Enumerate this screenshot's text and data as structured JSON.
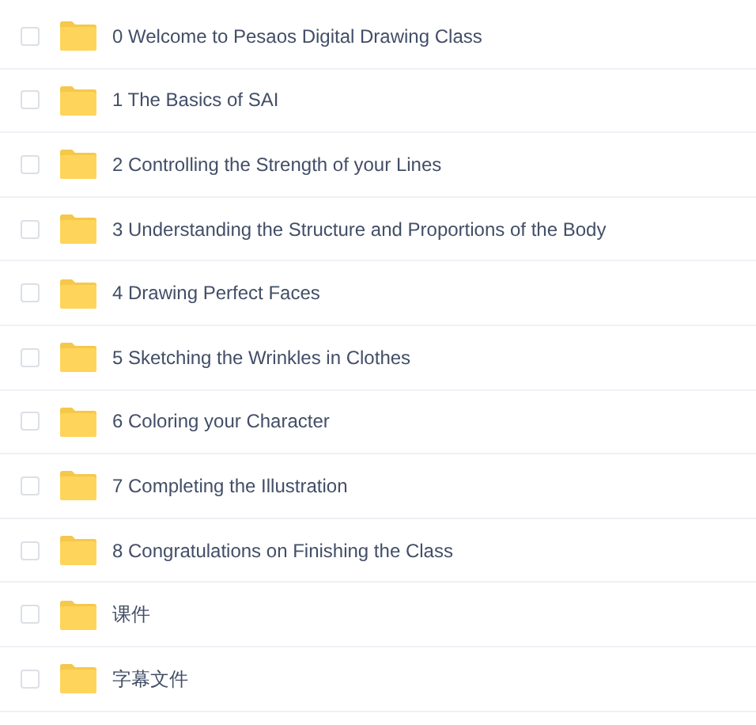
{
  "files": [
    {
      "name": "0 Welcome to Pesaos Digital Drawing Class",
      "checked": false
    },
    {
      "name": "1 The Basics of SAI",
      "checked": false
    },
    {
      "name": "2 Controlling the Strength of your Lines",
      "checked": false
    },
    {
      "name": "3 Understanding the Structure and Proportions of the Body",
      "checked": false
    },
    {
      "name": "4 Drawing Perfect Faces",
      "checked": false
    },
    {
      "name": "5 Sketching the Wrinkles in Clothes",
      "checked": false
    },
    {
      "name": "6 Coloring your Character",
      "checked": false
    },
    {
      "name": "7 Completing the Illustration",
      "checked": false
    },
    {
      "name": "8 Congratulations on Finishing the Class",
      "checked": false
    },
    {
      "name": "课件",
      "checked": false
    },
    {
      "name": "字幕文件",
      "checked": false
    }
  ]
}
